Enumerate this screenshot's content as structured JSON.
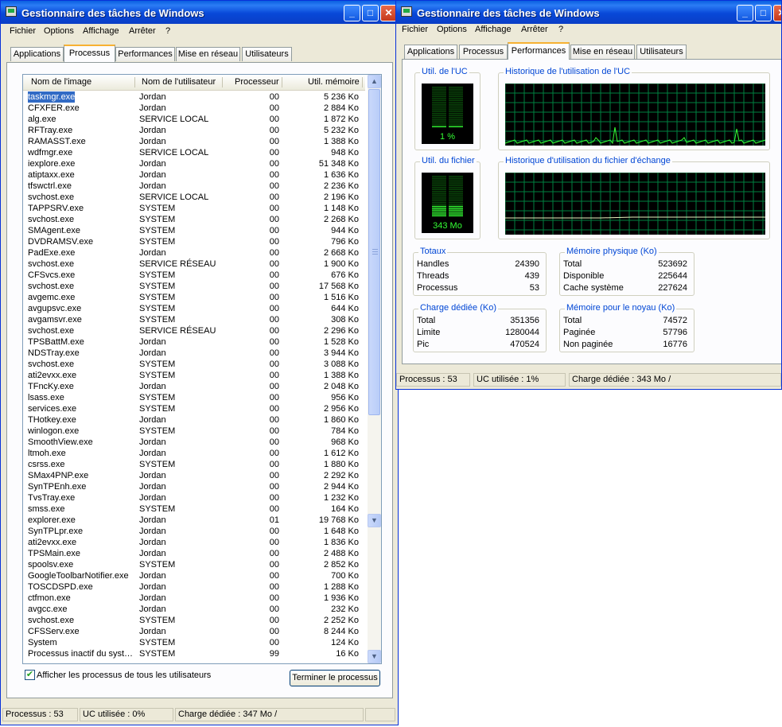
{
  "title": "Gestionnaire des tâches de Windows",
  "menu": [
    "Fichier",
    "Options",
    "Affichage",
    "Arrêter",
    "?"
  ],
  "tabs": [
    "Applications",
    "Processus",
    "Performances",
    "Mise en réseau",
    "Utilisateurs"
  ],
  "processes": {
    "columns": [
      "Nom de l'image",
      "Nom de l'utilisateur",
      "Processeur",
      "Util. mémoire"
    ],
    "rows": [
      [
        "taskmgr.exe",
        "Jordan",
        "00",
        "5 236 Ko"
      ],
      [
        "CFXFER.exe",
        "Jordan",
        "00",
        "2 884 Ko"
      ],
      [
        "alg.exe",
        "SERVICE LOCAL",
        "00",
        "1 872 Ko"
      ],
      [
        "RFTray.exe",
        "Jordan",
        "00",
        "5 232 Ko"
      ],
      [
        "RAMASST.exe",
        "Jordan",
        "00",
        "1 388 Ko"
      ],
      [
        "wdfmgr.exe",
        "SERVICE LOCAL",
        "00",
        "948 Ko"
      ],
      [
        "iexplore.exe",
        "Jordan",
        "00",
        "51 348 Ko"
      ],
      [
        "atiptaxx.exe",
        "Jordan",
        "00",
        "1 636 Ko"
      ],
      [
        "tfswctrl.exe",
        "Jordan",
        "00",
        "2 236 Ko"
      ],
      [
        "svchost.exe",
        "SERVICE LOCAL",
        "00",
        "2 196 Ko"
      ],
      [
        "TAPPSRV.exe",
        "SYSTEM",
        "00",
        "1 148 Ko"
      ],
      [
        "svchost.exe",
        "SYSTEM",
        "00",
        "2 268 Ko"
      ],
      [
        "SMAgent.exe",
        "SYSTEM",
        "00",
        "944 Ko"
      ],
      [
        "DVDRAMSV.exe",
        "SYSTEM",
        "00",
        "796 Ko"
      ],
      [
        "PadExe.exe",
        "Jordan",
        "00",
        "2 668 Ko"
      ],
      [
        "svchost.exe",
        "SERVICE RÉSEAU",
        "00",
        "1 900 Ko"
      ],
      [
        "CFSvcs.exe",
        "SYSTEM",
        "00",
        "676 Ko"
      ],
      [
        "svchost.exe",
        "SYSTEM",
        "00",
        "17 568 Ko"
      ],
      [
        "avgemc.exe",
        "SYSTEM",
        "00",
        "1 516 Ko"
      ],
      [
        "avgupsvc.exe",
        "SYSTEM",
        "00",
        "644 Ko"
      ],
      [
        "avgamsvr.exe",
        "SYSTEM",
        "00",
        "308 Ko"
      ],
      [
        "svchost.exe",
        "SERVICE RÉSEAU",
        "00",
        "2 296 Ko"
      ],
      [
        "TPSBattM.exe",
        "Jordan",
        "00",
        "1 528 Ko"
      ],
      [
        "NDSTray.exe",
        "Jordan",
        "00",
        "3 944 Ko"
      ],
      [
        "svchost.exe",
        "SYSTEM",
        "00",
        "3 088 Ko"
      ],
      [
        "ati2evxx.exe",
        "SYSTEM",
        "00",
        "1 388 Ko"
      ],
      [
        "TFncKy.exe",
        "Jordan",
        "00",
        "2 048 Ko"
      ],
      [
        "lsass.exe",
        "SYSTEM",
        "00",
        "956 Ko"
      ],
      [
        "services.exe",
        "SYSTEM",
        "00",
        "2 956 Ko"
      ],
      [
        "THotkey.exe",
        "Jordan",
        "00",
        "1 860 Ko"
      ],
      [
        "winlogon.exe",
        "SYSTEM",
        "00",
        "784 Ko"
      ],
      [
        "SmoothView.exe",
        "Jordan",
        "00",
        "968 Ko"
      ],
      [
        "ltmoh.exe",
        "Jordan",
        "00",
        "1 612 Ko"
      ],
      [
        "csrss.exe",
        "SYSTEM",
        "00",
        "1 880 Ko"
      ],
      [
        "SMax4PNP.exe",
        "Jordan",
        "00",
        "2 292 Ko"
      ],
      [
        "SynTPEnh.exe",
        "Jordan",
        "00",
        "2 944 Ko"
      ],
      [
        "TvsTray.exe",
        "Jordan",
        "00",
        "1 232 Ko"
      ],
      [
        "smss.exe",
        "SYSTEM",
        "00",
        "164 Ko"
      ],
      [
        "explorer.exe",
        "Jordan",
        "01",
        "19 768 Ko"
      ],
      [
        "SynTPLpr.exe",
        "Jordan",
        "00",
        "1 648 Ko"
      ],
      [
        "ati2evxx.exe",
        "Jordan",
        "00",
        "1 836 Ko"
      ],
      [
        "TPSMain.exe",
        "Jordan",
        "00",
        "2 488 Ko"
      ],
      [
        "spoolsv.exe",
        "SYSTEM",
        "00",
        "2 852 Ko"
      ],
      [
        "GoogleToolbarNotifier.exe",
        "Jordan",
        "00",
        "700 Ko"
      ],
      [
        "TOSCDSPD.exe",
        "Jordan",
        "00",
        "1 288 Ko"
      ],
      [
        "ctfmon.exe",
        "Jordan",
        "00",
        "1 936 Ko"
      ],
      [
        "avgcc.exe",
        "Jordan",
        "00",
        "232 Ko"
      ],
      [
        "svchost.exe",
        "SYSTEM",
        "00",
        "2 252 Ko"
      ],
      [
        "CFSServ.exe",
        "Jordan",
        "00",
        "8 244 Ko"
      ],
      [
        "System",
        "SYSTEM",
        "00",
        "124 Ko"
      ],
      [
        "Processus inactif du syst…",
        "SYSTEM",
        "99",
        "16 Ko"
      ]
    ],
    "selected_index": 0,
    "show_all_label": "Afficher les processus de tous les utilisateurs",
    "show_all_checked": true,
    "end_process_label": "Terminer le processus"
  },
  "status_processes": {
    "processes": "Processus : 53",
    "cpu": "UC utilisée : 0%",
    "commit": "Charge dédiée : 347 Mo /"
  },
  "performance": {
    "cpu_usage_label": "Util. de l'UC",
    "cpu_usage_value": "1 %",
    "cpu_usage_fraction": 0.01,
    "cpu_history_label": "Historique de l'utilisation de l'UC",
    "pf_usage_label": "Util. du fichier",
    "pf_usage_value": "343 Mo",
    "pf_usage_fraction": 0.27,
    "pf_history_label": "Historique d'utilisation du fichier d'échange",
    "totals": {
      "label": "Totaux",
      "rows": [
        [
          "Handles",
          "24390"
        ],
        [
          "Threads",
          "439"
        ],
        [
          "Processus",
          "53"
        ]
      ]
    },
    "physical": {
      "label": "Mémoire physique (Ko)",
      "rows": [
        [
          "Total",
          "523692"
        ],
        [
          "Disponible",
          "225644"
        ],
        [
          "Cache système",
          "227624"
        ]
      ]
    },
    "commit": {
      "label": "Charge dédiée (Ko)",
      "rows": [
        [
          "Total",
          "351356"
        ],
        [
          "Limite",
          "1280044"
        ],
        [
          "Pic",
          "470524"
        ]
      ]
    },
    "kernel": {
      "label": "Mémoire pour le noyau (Ko)",
      "rows": [
        [
          "Total",
          "74572"
        ],
        [
          "Paginée",
          "57796"
        ],
        [
          "Non paginée",
          "16776"
        ]
      ]
    }
  },
  "status_performance": {
    "processes": "Processus : 53",
    "cpu": "UC utilisée : 1%",
    "commit": "Charge dédiée : 343 Mo /"
  },
  "colors": {
    "meter_green": "#34ff34",
    "grid_green": "#008040",
    "title_blue": "#0a5fe0",
    "selection": "#316ac5"
  }
}
